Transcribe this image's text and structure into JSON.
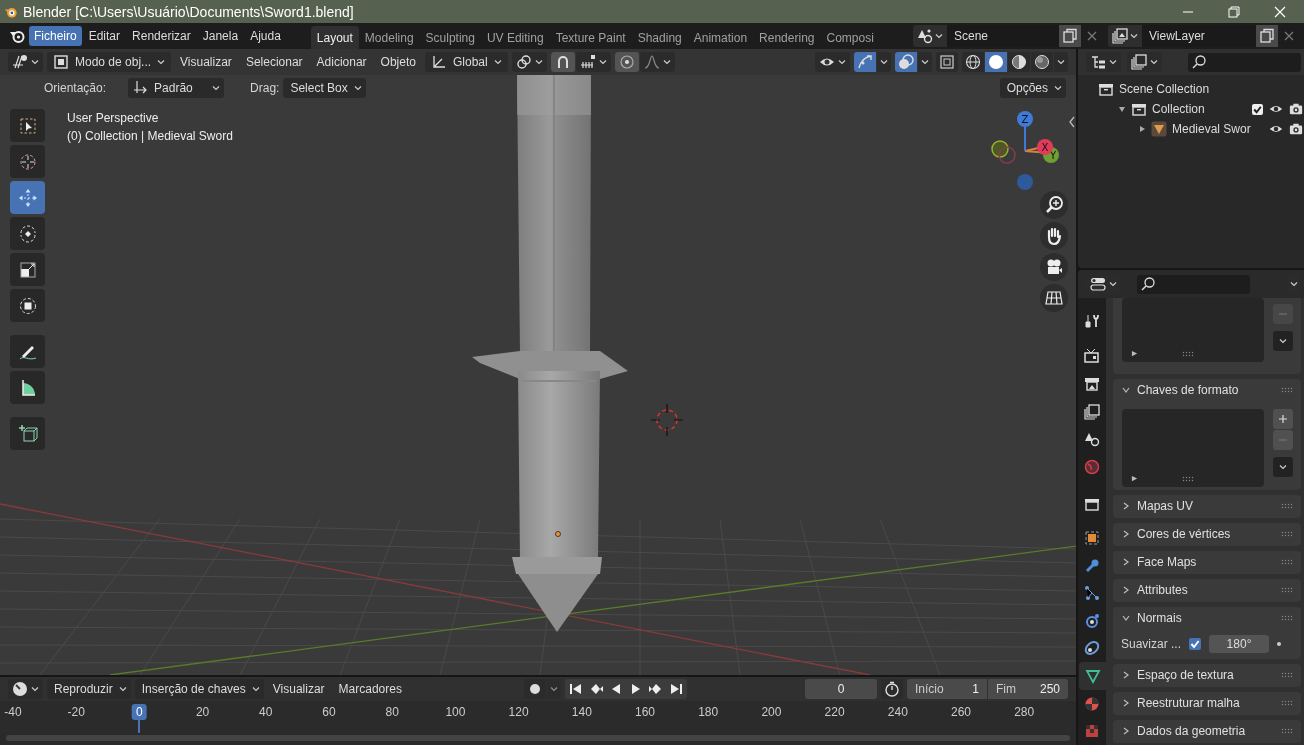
{
  "window": {
    "title": "Blender [C:\\Users\\Usuário\\Documents\\Sword1.blend]"
  },
  "menu_bar": [
    {
      "label": "Ficheiro",
      "selected": true
    },
    {
      "label": "Editar",
      "selected": false
    },
    {
      "label": "Renderizar",
      "selected": false
    },
    {
      "label": "Janela",
      "selected": false
    },
    {
      "label": "Ajuda",
      "selected": false
    }
  ],
  "workspaces": [
    {
      "label": "Layout",
      "selected": true
    },
    {
      "label": "Modeling",
      "selected": false
    },
    {
      "label": "Sculpting",
      "selected": false
    },
    {
      "label": "UV Editing",
      "selected": false
    },
    {
      "label": "Texture Paint",
      "selected": false
    },
    {
      "label": "Shading",
      "selected": false
    },
    {
      "label": "Animation",
      "selected": false
    },
    {
      "label": "Rendering",
      "selected": false
    },
    {
      "label": "Composi",
      "selected": false
    }
  ],
  "scene": {
    "value": "Scene"
  },
  "view_layer": {
    "value": "ViewLayer"
  },
  "viewport": {
    "mode": "Modo de obj...",
    "menus": [
      "Visualizar",
      "Selecionar",
      "Adicionar",
      "Objeto"
    ],
    "transform_orientation": "Global",
    "toggles": [
      {
        "kind": "gizmos",
        "on": true
      },
      {
        "kind": "overlays",
        "on": true
      },
      {
        "kind": "xray",
        "on": false
      }
    ],
    "shading": [
      {
        "kind": "wireframe",
        "selected": false
      },
      {
        "kind": "solid",
        "selected": true
      },
      {
        "kind": "material",
        "selected": false
      },
      {
        "kind": "rendered",
        "selected": false
      }
    ],
    "tool_settings": {
      "orientation_label": "Orientação:",
      "orientation": "Padrão",
      "drag_label": "Drag:",
      "drag": "Select Box",
      "options": "Opções"
    },
    "info": [
      "User Perspective",
      "(0) Collection | Medieval Sword"
    ],
    "tools": [
      {
        "kind": "select_box",
        "selected": false
      },
      {
        "kind": "cursor",
        "selected": false
      },
      {
        "kind": "move",
        "selected": true
      },
      {
        "kind": "rotate",
        "selected": false
      },
      {
        "kind": "scale",
        "selected": false
      },
      {
        "kind": "transform",
        "selected": false
      },
      {
        "kind": "annotate",
        "selected": false
      },
      {
        "kind": "measure",
        "selected": false
      },
      {
        "kind": "add_cube",
        "selected": false
      }
    ],
    "gizmo_axes": [
      "Z",
      "X",
      "Y"
    ]
  },
  "outliner": {
    "tree": [
      {
        "label": "Scene Collection",
        "kind": "scene_collection",
        "children": [
          {
            "label": "Collection",
            "kind": "collection",
            "expanded": true,
            "checked": true,
            "children": [
              {
                "label": "Medieval Swor",
                "kind": "mesh_object",
                "expanded": false
              }
            ]
          }
        ]
      }
    ]
  },
  "properties": {
    "tabs": [
      {
        "kind": "tool",
        "selected": false
      },
      {
        "kind": "render",
        "selected": false
      },
      {
        "kind": "output",
        "selected": false
      },
      {
        "kind": "view_layer",
        "selected": false
      },
      {
        "kind": "scene",
        "selected": false
      },
      {
        "kind": "world",
        "selected": false
      },
      {
        "kind": "collection",
        "selected": false
      },
      {
        "kind": "object",
        "selected": false
      },
      {
        "kind": "modifiers",
        "selected": false
      },
      {
        "kind": "particles",
        "selected": false
      },
      {
        "kind": "physics",
        "selected": false
      },
      {
        "kind": "constraints",
        "selected": false
      },
      {
        "kind": "data",
        "selected": true
      },
      {
        "kind": "material",
        "selected": false
      },
      {
        "kind": "texture",
        "selected": false
      }
    ],
    "panels": [
      {
        "title": "Chaves de formato",
        "expanded": true,
        "kind": "list"
      },
      {
        "title": "Mapas UV",
        "expanded": false
      },
      {
        "title": "Cores de vértices",
        "expanded": false
      },
      {
        "title": "Face Maps",
        "expanded": false
      },
      {
        "title": "Attributes",
        "expanded": false
      },
      {
        "title": "Normais",
        "expanded": true,
        "kind": "auto_smooth",
        "label": "Suavizar ...",
        "checked": true,
        "value": "180°"
      },
      {
        "title": "Espaço de textura",
        "expanded": false
      },
      {
        "title": "Reestruturar malha",
        "expanded": false
      },
      {
        "title": "Dados da geometria",
        "expanded": false
      }
    ]
  },
  "timeline": {
    "menus": [
      {
        "label": "Reproduzir",
        "kind": "dropdown"
      },
      {
        "label": "Inserção de chaves",
        "kind": "dropdown"
      },
      {
        "label": "Visualizar",
        "kind": "menu"
      },
      {
        "label": "Marcadores",
        "kind": "menu"
      }
    ],
    "current_frame": "0",
    "start_label": "Início",
    "start": "1",
    "end_label": "Fim",
    "end": "250",
    "ruler": [
      {
        "label": "-40",
        "selected": false
      },
      {
        "label": "-20",
        "selected": false
      },
      {
        "label": "0",
        "selected": true
      },
      {
        "label": "20",
        "selected": false
      },
      {
        "label": "40",
        "selected": false
      },
      {
        "label": "60",
        "selected": false
      },
      {
        "label": "80",
        "selected": false
      },
      {
        "label": "100",
        "selected": false
      },
      {
        "label": "120",
        "selected": false
      },
      {
        "label": "140",
        "selected": false
      },
      {
        "label": "160",
        "selected": false
      },
      {
        "label": "180",
        "selected": false
      },
      {
        "label": "200",
        "selected": false
      },
      {
        "label": "220",
        "selected": false
      },
      {
        "label": "240",
        "selected": false
      },
      {
        "label": "260",
        "selected": false
      },
      {
        "label": "280",
        "selected": false
      }
    ]
  }
}
